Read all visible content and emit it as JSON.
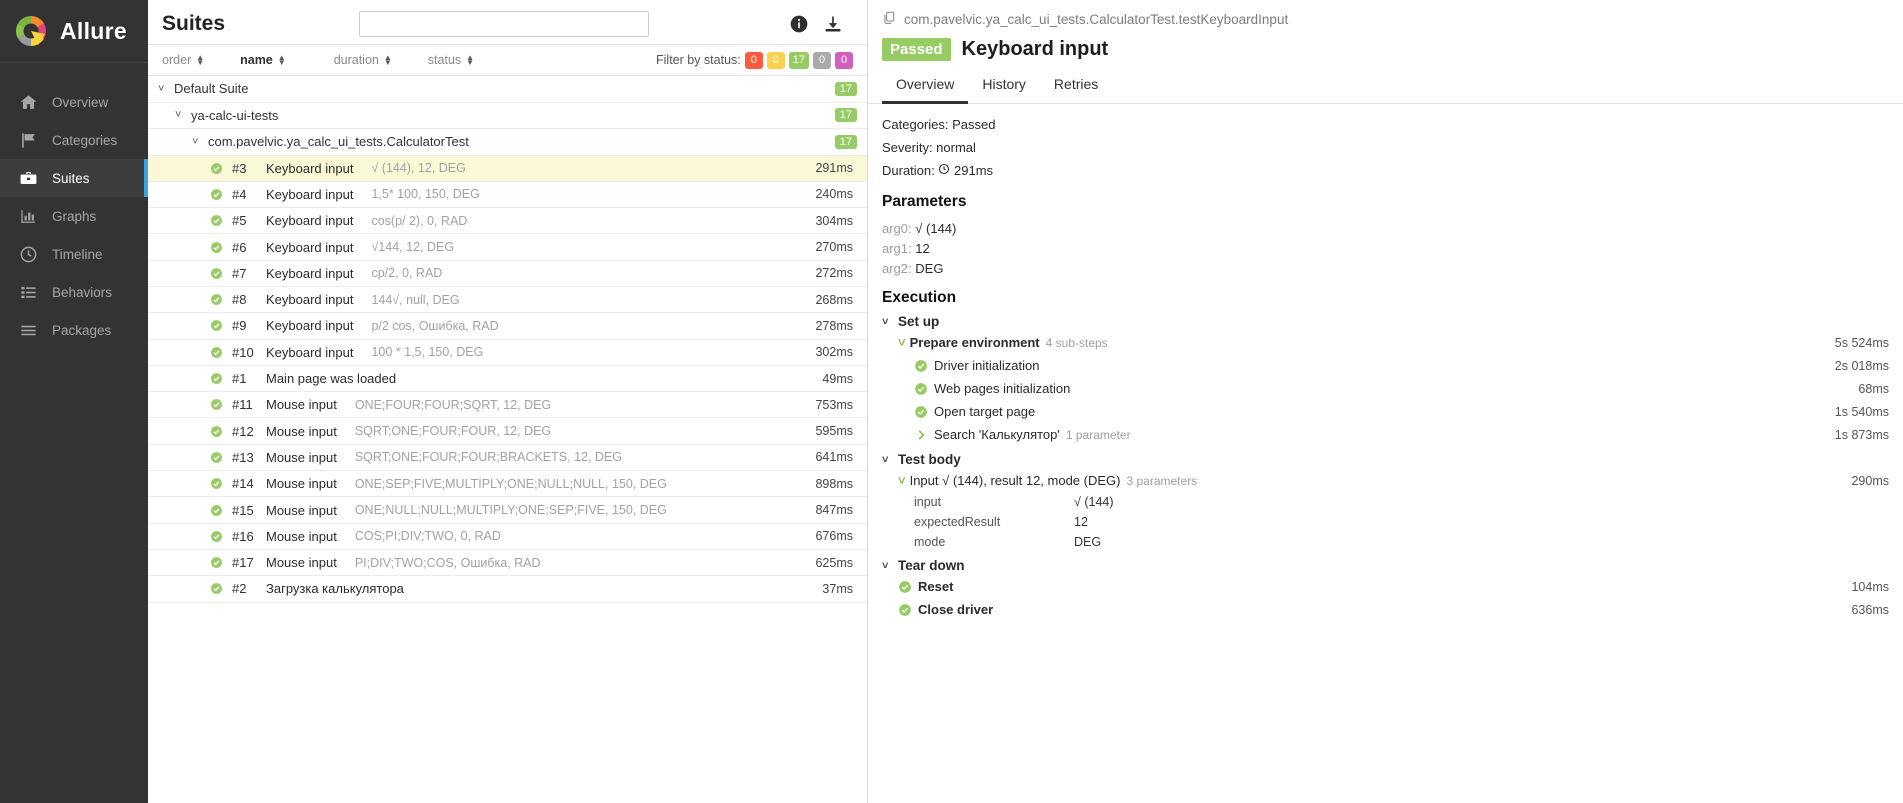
{
  "brand": {
    "name": "Allure",
    "logo_icon": "allure-logo-icon"
  },
  "sidebar": {
    "items": [
      {
        "label": "Overview",
        "icon": "home-icon",
        "active": false
      },
      {
        "label": "Categories",
        "icon": "flag-icon",
        "active": false
      },
      {
        "label": "Suites",
        "icon": "briefcase-icon",
        "active": true
      },
      {
        "label": "Graphs",
        "icon": "bar-chart-icon",
        "active": false
      },
      {
        "label": "Timeline",
        "icon": "clock-icon",
        "active": false
      },
      {
        "label": "Behaviors",
        "icon": "list-icon",
        "active": false
      },
      {
        "label": "Packages",
        "icon": "menu-icon",
        "active": false
      }
    ]
  },
  "suites": {
    "title": "Suites",
    "search_value": "",
    "search_placeholder": "",
    "info_icon": "info-icon",
    "download_icon": "download-icon",
    "sort": {
      "order": "order",
      "name": "name",
      "duration": "duration",
      "status": "status"
    },
    "filter": {
      "label": "Filter by status:",
      "badges": [
        {
          "value": "0",
          "color": "#fd5a3e"
        },
        {
          "value": "0",
          "color": "#ffd050"
        },
        {
          "value": "17",
          "color": "#97cc64"
        },
        {
          "value": "0",
          "color": "#aaa"
        },
        {
          "value": "0",
          "color": "#d35ebe"
        }
      ]
    },
    "groups": [
      {
        "label": "Default Suite",
        "count": "17",
        "level": 1
      },
      {
        "label": "ya-calc-ui-tests",
        "count": "17",
        "level": 2
      },
      {
        "label": "com.pavelvic.ya_calc_ui_tests.CalculatorTest",
        "count": "17",
        "level": 3
      }
    ],
    "tests": [
      {
        "num": "#3",
        "name": "Keyboard input",
        "params": "√ (144), 12, DEG",
        "duration": "291ms",
        "status": "passed",
        "selected": true
      },
      {
        "num": "#4",
        "name": "Keyboard input",
        "params": "1,5* 100, 150, DEG",
        "duration": "240ms",
        "status": "passed",
        "selected": false
      },
      {
        "num": "#5",
        "name": "Keyboard input",
        "params": "cos(p/ 2), 0, RAD",
        "duration": "304ms",
        "status": "passed",
        "selected": false
      },
      {
        "num": "#6",
        "name": "Keyboard input",
        "params": "√144, 12, DEG",
        "duration": "270ms",
        "status": "passed",
        "selected": false
      },
      {
        "num": "#7",
        "name": "Keyboard input",
        "params": "cp/2, 0, RAD",
        "duration": "272ms",
        "status": "passed",
        "selected": false
      },
      {
        "num": "#8",
        "name": "Keyboard input",
        "params": "144√, null, DEG",
        "duration": "268ms",
        "status": "passed",
        "selected": false
      },
      {
        "num": "#9",
        "name": "Keyboard input",
        "params": "p/2 cos, Ошибка, RAD",
        "duration": "278ms",
        "status": "passed",
        "selected": false
      },
      {
        "num": "#10",
        "name": "Keyboard input",
        "params": "100 * 1,5, 150, DEG",
        "duration": "302ms",
        "status": "passed",
        "selected": false
      },
      {
        "num": "#1",
        "name": "Main page was loaded",
        "params": "",
        "duration": "49ms",
        "status": "passed",
        "selected": false
      },
      {
        "num": "#11",
        "name": "Mouse input",
        "params": "ONE;FOUR;FOUR;SQRT, 12, DEG",
        "duration": "753ms",
        "status": "passed",
        "selected": false
      },
      {
        "num": "#12",
        "name": "Mouse input",
        "params": "SQRT;ONE;FOUR;FOUR, 12, DEG",
        "duration": "595ms",
        "status": "passed",
        "selected": false
      },
      {
        "num": "#13",
        "name": "Mouse input",
        "params": "SQRT;ONE;FOUR;FOUR;BRACKETS, 12, DEG",
        "duration": "641ms",
        "status": "passed",
        "selected": false
      },
      {
        "num": "#14",
        "name": "Mouse input",
        "params": "ONE;SEP;FIVE;MULTIPLY;ONE;NULL;NULL, 150, DEG",
        "duration": "898ms",
        "status": "passed",
        "selected": false
      },
      {
        "num": "#15",
        "name": "Mouse input",
        "params": "ONE;NULL;NULL;MULTIPLY;ONE;SEP;FIVE, 150, DEG",
        "duration": "847ms",
        "status": "passed",
        "selected": false
      },
      {
        "num": "#16",
        "name": "Mouse input",
        "params": "COS;PI;DIV;TWO, 0, RAD",
        "duration": "676ms",
        "status": "passed",
        "selected": false
      },
      {
        "num": "#17",
        "name": "Mouse input",
        "params": "PI;DIV;TWO;COS, Ошибка, RAD",
        "duration": "625ms",
        "status": "passed",
        "selected": false
      },
      {
        "num": "#2",
        "name": "Загрузка калькулятора",
        "params": "",
        "duration": "37ms",
        "status": "passed",
        "selected": false
      }
    ]
  },
  "detail": {
    "path": "com.pavelvic.ya_calc_ui_tests.CalculatorTest.testKeyboardInput",
    "copy_icon": "copy-icon",
    "status_chip": "Passed",
    "title": "Keyboard input",
    "tabs": [
      {
        "label": "Overview",
        "active": true
      },
      {
        "label": "History",
        "active": false
      },
      {
        "label": "Retries",
        "active": false
      }
    ],
    "meta": {
      "categories": "Categories: Passed",
      "severity": "Severity: normal",
      "duration_label": "Duration:",
      "duration_value": "291ms"
    },
    "parameters_heading": "Parameters",
    "parameters": [
      {
        "key": "arg0",
        "value": "√ (144)"
      },
      {
        "key": "arg1",
        "value": "12"
      },
      {
        "key": "arg2",
        "value": "DEG"
      }
    ],
    "execution_heading": "Execution",
    "setup": {
      "label": "Set up",
      "group_step": {
        "label": "Prepare environment",
        "substeps": "4 sub-steps",
        "time": "5s 524ms"
      },
      "steps": [
        {
          "label": "Driver initialization",
          "time": "2s 018ms",
          "expandable": false
        },
        {
          "label": "Web pages initialization",
          "time": "68ms",
          "expandable": false
        },
        {
          "label": "Open target page",
          "time": "1s 540ms",
          "expandable": false
        },
        {
          "label": "Search 'Калькулятор'",
          "substeps": "1 parameter",
          "time": "1s 873ms",
          "expandable": true
        }
      ]
    },
    "test_body": {
      "label": "Test body",
      "step": {
        "label": "Input √ (144), result 12, mode (DEG)",
        "substeps": "3 parameters",
        "time": "290ms"
      },
      "params": [
        {
          "key": "input",
          "value": "√ (144)"
        },
        {
          "key": "expectedResult",
          "value": "12"
        },
        {
          "key": "mode",
          "value": "DEG"
        }
      ]
    },
    "teardown": {
      "label": "Tear down",
      "steps": [
        {
          "label": "Reset",
          "time": "104ms"
        },
        {
          "label": "Close driver",
          "time": "636ms"
        }
      ]
    }
  },
  "colors": {
    "passed": "#97cc64",
    "accent": "#39a5dc",
    "selected_row": "#fbf8d8",
    "sidebar_bg": "#333333"
  }
}
